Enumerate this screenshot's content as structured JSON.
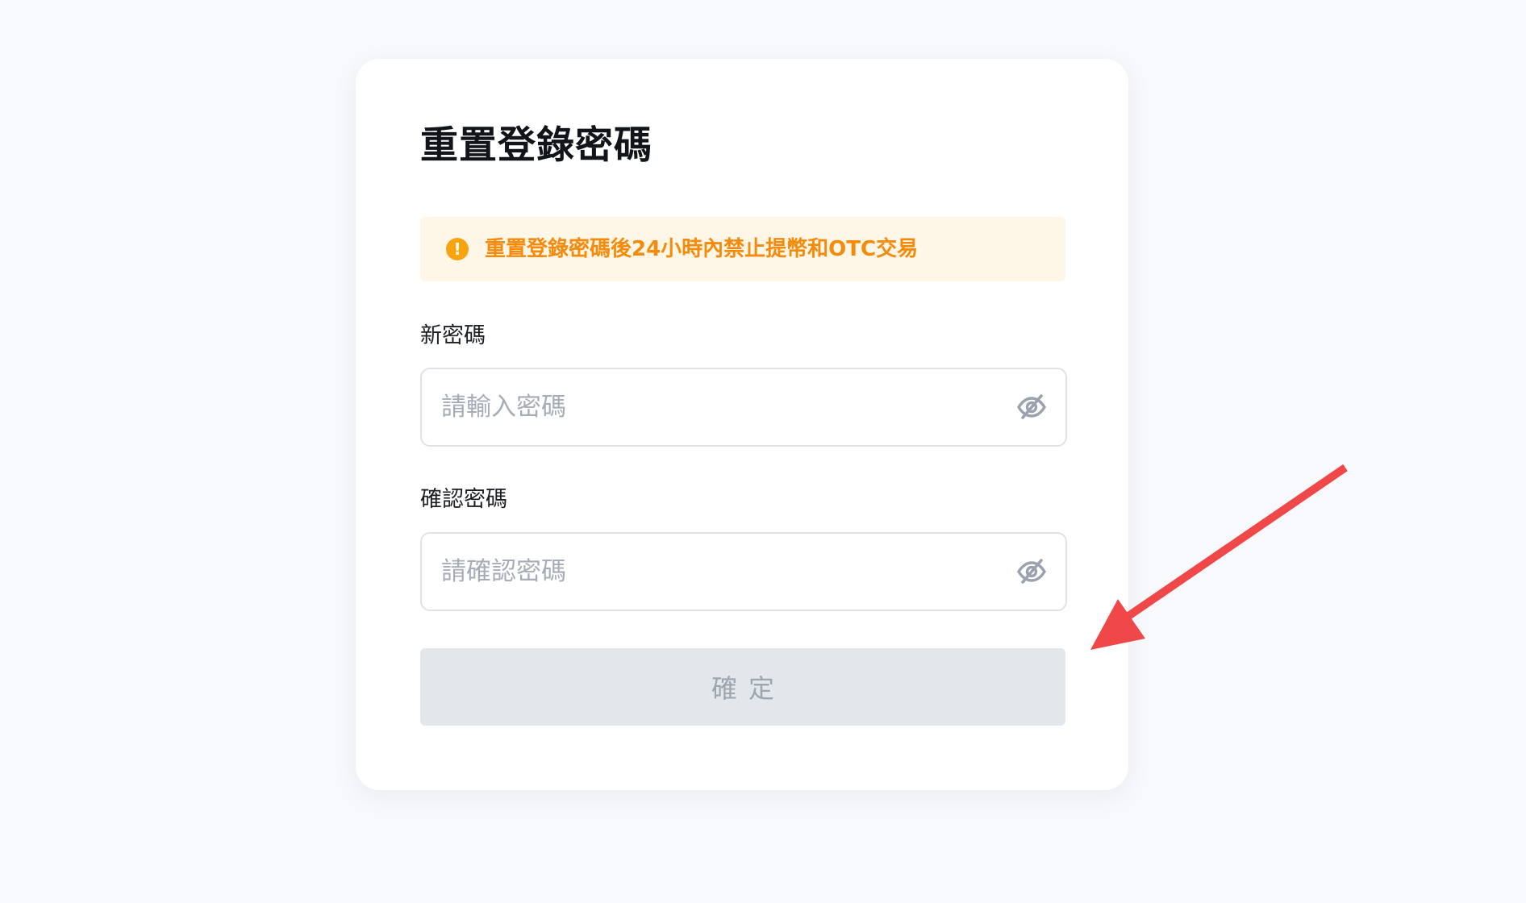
{
  "form": {
    "title": "重置登錄密碼",
    "warning": {
      "icon": "exclamation-circle-icon",
      "text": "重置登錄密碼後24小時內禁止提幣和OTC交易",
      "color": "#f58a0b"
    },
    "new_password": {
      "label": "新密碼",
      "placeholder": "請輸入密碼",
      "value": "",
      "toggle_icon": "eye-off-icon"
    },
    "confirm_password": {
      "label": "確認密碼",
      "placeholder": "請確認密碼",
      "value": "",
      "toggle_icon": "eye-off-icon"
    },
    "submit_label": "確定"
  },
  "annotation": {
    "type": "arrow",
    "color": "#f04848"
  },
  "colors": {
    "background": "#f7f9fd",
    "card": "#ffffff",
    "warning_bg": "#fef6e7",
    "warning_icon": "#f7a40f",
    "button_disabled_bg": "#e2e7ec",
    "button_disabled_text": "#9ea5ae"
  }
}
